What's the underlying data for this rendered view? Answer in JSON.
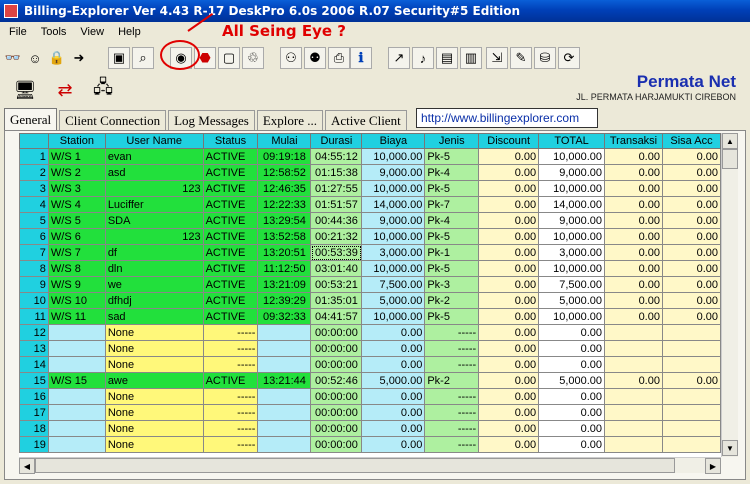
{
  "window": {
    "title": "Billing-Explorer Ver 4.43 R-17 DeskPro 6.0s 2006 R.07 Security#5 Edition"
  },
  "menu": [
    "File",
    "Tools",
    "View",
    "Help"
  ],
  "annotation": "All Seing Eye ?",
  "toolbar": {
    "icons": [
      "binoculars-icon",
      "smiley-icon",
      "lock-icon",
      "arrow-icon",
      "monitor-icon",
      "magnifier-icon",
      "eye-icon",
      "stop-icon",
      "frame-icon",
      "recycle-icon",
      "people-icon",
      "people2-icon",
      "printer-icon",
      "info-icon",
      "chart-icon",
      "speaker-icon",
      "document-icon",
      "cash-icon",
      "export-icon",
      "pen-icon",
      "database-icon",
      "refresh-icon"
    ]
  },
  "brand": {
    "name": "Permata Net",
    "address": "JL. PERMATA HARJAMUKTI  CIREBON"
  },
  "tabs": [
    "General",
    "Client Connection",
    "Log Messages",
    "Explore ...",
    "Active Client"
  ],
  "url": "http://www.billingexplorer.com",
  "columns": [
    "Station",
    "User Name",
    "Status",
    "Mulai",
    "Durasi",
    "Biaya",
    "Jenis",
    "Discount",
    "TOTAL",
    "Transaksi",
    "Sisa Acc"
  ],
  "rows": [
    {
      "no": "1",
      "station": "W/S 1",
      "user": "evan",
      "status": "ACTIVE",
      "mulai": "09:19:18",
      "durasi": "04:55:12",
      "biaya": "10,000.00",
      "jenis": "Pk-5",
      "discount": "0.00",
      "total": "10,000.00",
      "transaksi": "0.00",
      "sisa": "0.00",
      "active": true
    },
    {
      "no": "2",
      "station": "W/S 2",
      "user": "asd",
      "status": "ACTIVE",
      "mulai": "12:58:52",
      "durasi": "01:15:38",
      "biaya": "9,000.00",
      "jenis": "Pk-4",
      "discount": "0.00",
      "total": "9,000.00",
      "transaksi": "0.00",
      "sisa": "0.00",
      "active": true
    },
    {
      "no": "3",
      "station": "W/S 3",
      "user": "123",
      "status": "ACTIVE",
      "mulai": "12:46:35",
      "durasi": "01:27:55",
      "biaya": "10,000.00",
      "jenis": "Pk-5",
      "discount": "0.00",
      "total": "10,000.00",
      "transaksi": "0.00",
      "sisa": "0.00",
      "active": true,
      "user_right": true
    },
    {
      "no": "4",
      "station": "W/S 4",
      "user": "Luciffer",
      "status": "ACTIVE",
      "mulai": "12:22:33",
      "durasi": "01:51:57",
      "biaya": "14,000.00",
      "jenis": "Pk-7",
      "discount": "0.00",
      "total": "14,000.00",
      "transaksi": "0.00",
      "sisa": "0.00",
      "active": true
    },
    {
      "no": "5",
      "station": "W/S 5",
      "user": "SDA",
      "status": "ACTIVE",
      "mulai": "13:29:54",
      "durasi": "00:44:36",
      "biaya": "9,000.00",
      "jenis": "Pk-4",
      "discount": "0.00",
      "total": "9,000.00",
      "transaksi": "0.00",
      "sisa": "0.00",
      "active": true
    },
    {
      "no": "6",
      "station": "W/S 6",
      "user": "123",
      "status": "ACTIVE",
      "mulai": "13:52:58",
      "durasi": "00:21:32",
      "biaya": "10,000.00",
      "jenis": "Pk-5",
      "discount": "0.00",
      "total": "10,000.00",
      "transaksi": "0.00",
      "sisa": "0.00",
      "active": true,
      "user_right": true
    },
    {
      "no": "7",
      "station": "W/S 7",
      "user": "df",
      "status": "ACTIVE",
      "mulai": "13:20:51",
      "durasi": "00:53:39",
      "biaya": "3,000.00",
      "jenis": "Pk-1",
      "discount": "0.00",
      "total": "3,000.00",
      "transaksi": "0.00",
      "sisa": "0.00",
      "active": true,
      "selected": true
    },
    {
      "no": "8",
      "station": "W/S 8",
      "user": "dln",
      "status": "ACTIVE",
      "mulai": "11:12:50",
      "durasi": "03:01:40",
      "biaya": "10,000.00",
      "jenis": "Pk-5",
      "discount": "0.00",
      "total": "10,000.00",
      "transaksi": "0.00",
      "sisa": "0.00",
      "active": true
    },
    {
      "no": "9",
      "station": "W/S 9",
      "user": "we",
      "status": "ACTIVE",
      "mulai": "13:21:09",
      "durasi": "00:53:21",
      "biaya": "7,500.00",
      "jenis": "Pk-3",
      "discount": "0.00",
      "total": "7,500.00",
      "transaksi": "0.00",
      "sisa": "0.00",
      "active": true
    },
    {
      "no": "10",
      "station": "W/S 10",
      "user": "dfhdj",
      "status": "ACTIVE",
      "mulai": "12:39:29",
      "durasi": "01:35:01",
      "biaya": "5,000.00",
      "jenis": "Pk-2",
      "discount": "0.00",
      "total": "5,000.00",
      "transaksi": "0.00",
      "sisa": "0.00",
      "active": true
    },
    {
      "no": "11",
      "station": "W/S 11",
      "user": "sad",
      "status": "ACTIVE",
      "mulai": "09:32:33",
      "durasi": "04:41:57",
      "biaya": "10,000.00",
      "jenis": "Pk-5",
      "discount": "0.00",
      "total": "10,000.00",
      "transaksi": "0.00",
      "sisa": "0.00",
      "active": true
    },
    {
      "no": "12",
      "station": "",
      "user": "None",
      "status": "-----",
      "mulai": "",
      "durasi": "00:00:00",
      "biaya": "0.00",
      "jenis": "-----",
      "discount": "0.00",
      "total": "0.00",
      "transaksi": "",
      "sisa": "",
      "active": false
    },
    {
      "no": "13",
      "station": "",
      "user": "None",
      "status": "-----",
      "mulai": "",
      "durasi": "00:00:00",
      "biaya": "0.00",
      "jenis": "-----",
      "discount": "0.00",
      "total": "0.00",
      "transaksi": "",
      "sisa": "",
      "active": false
    },
    {
      "no": "14",
      "station": "",
      "user": "None",
      "status": "-----",
      "mulai": "",
      "durasi": "00:00:00",
      "biaya": "0.00",
      "jenis": "-----",
      "discount": "0.00",
      "total": "0.00",
      "transaksi": "",
      "sisa": "",
      "active": false
    },
    {
      "no": "15",
      "station": "W/S 15",
      "user": "awe",
      "status": "ACTIVE",
      "mulai": "13:21:44",
      "durasi": "00:52:46",
      "biaya": "5,000.00",
      "jenis": "Pk-2",
      "discount": "0.00",
      "total": "5,000.00",
      "transaksi": "0.00",
      "sisa": "0.00",
      "active": true
    },
    {
      "no": "16",
      "station": "",
      "user": "None",
      "status": "-----",
      "mulai": "",
      "durasi": "00:00:00",
      "biaya": "0.00",
      "jenis": "-----",
      "discount": "0.00",
      "total": "0.00",
      "transaksi": "",
      "sisa": "",
      "active": false
    },
    {
      "no": "17",
      "station": "",
      "user": "None",
      "status": "-----",
      "mulai": "",
      "durasi": "00:00:00",
      "biaya": "0.00",
      "jenis": "-----",
      "discount": "0.00",
      "total": "0.00",
      "transaksi": "",
      "sisa": "",
      "active": false
    },
    {
      "no": "18",
      "station": "",
      "user": "None",
      "status": "-----",
      "mulai": "",
      "durasi": "00:00:00",
      "biaya": "0.00",
      "jenis": "-----",
      "discount": "0.00",
      "total": "0.00",
      "transaksi": "",
      "sisa": "",
      "active": false
    },
    {
      "no": "19",
      "station": "",
      "user": "None",
      "status": "-----",
      "mulai": "",
      "durasi": "00:00:00",
      "biaya": "0.00",
      "jenis": "-----",
      "discount": "0.00",
      "total": "0.00",
      "transaksi": "",
      "sisa": "",
      "active": false
    }
  ]
}
